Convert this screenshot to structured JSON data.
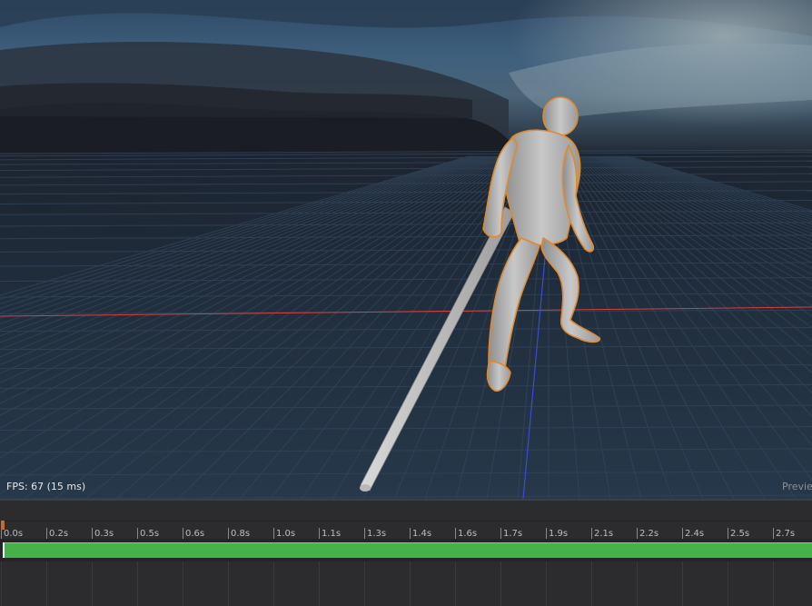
{
  "viewport": {
    "fps_text": "FPS: 67 (15 ms)",
    "preview_label": "Preview"
  },
  "timeline": {
    "ticks": [
      "0.0s",
      "0.2s",
      "0.3s",
      "0.5s",
      "0.6s",
      "0.8s",
      "1.0s",
      "1.1s",
      "1.3s",
      "1.4s",
      "1.6s",
      "1.7s",
      "1.9s",
      "2.1s",
      "2.2s",
      "2.4s",
      "2.5s",
      "2.7s"
    ],
    "clip_color": "#46b14b",
    "playhead_color": "#c86a2a"
  },
  "colors": {
    "x_axis": "#d84040",
    "z_axis": "#3a4bd8",
    "character_outline": "#e08a2c",
    "character_body": "#b5b5b5"
  },
  "icons": [
    "character-model",
    "staff-prop"
  ]
}
